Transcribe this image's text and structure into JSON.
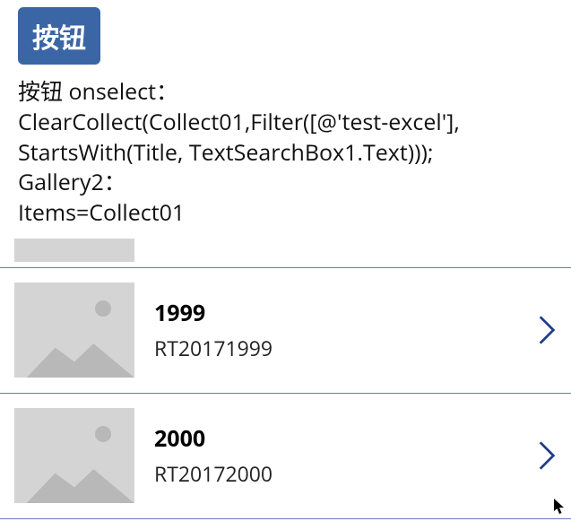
{
  "button": {
    "label": "按钮"
  },
  "code": {
    "line1": "按钮 onselect：",
    "line2": "ClearCollect(Collect01,Filter([@'test-excel'],",
    "line3": "StartsWith(Title, TextSearchBox1.Text)));",
    "line4": "Gallery2：",
    "line5": "Items=Collect01"
  },
  "gallery": {
    "rows": [
      {
        "title": "1999",
        "subtitle": "RT20171999"
      },
      {
        "title": "2000",
        "subtitle": "RT20172000"
      }
    ]
  }
}
